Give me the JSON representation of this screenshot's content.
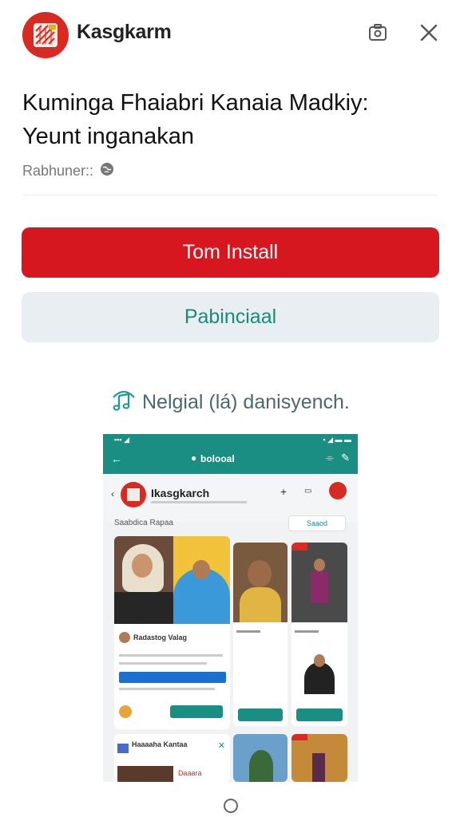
{
  "header": {
    "app_name": "Kasgkarm",
    "icons": [
      "camera-icon",
      "close-icon"
    ]
  },
  "headline": {
    "line1": "Kuminga Fhaiabri Kanaia Madkiy:",
    "line2": "Yeunt inganakan"
  },
  "publisher": {
    "label": "Rabhuner::",
    "icon": "globe-icon"
  },
  "buttons": {
    "primary": "Tom Install",
    "secondary": "Pabinciaal"
  },
  "preview": {
    "caption": "Nelgial (lá) danisyench.",
    "caption_icon": "music-note-icon",
    "phone": {
      "bar_title": "bolooal",
      "app_name": "Ikasgkarch",
      "section_label": "Saabdica Rapaa",
      "section_action": "Saaod",
      "card_title": "Radastog Valag",
      "list_title": "Haaaaha Kantaa",
      "tag": "Daaara"
    }
  },
  "colors": {
    "brand_red": "#d7171f",
    "teal": "#1b8e84",
    "secondary_bg": "#e9eef2",
    "secondary_text": "#1a8a7a"
  }
}
